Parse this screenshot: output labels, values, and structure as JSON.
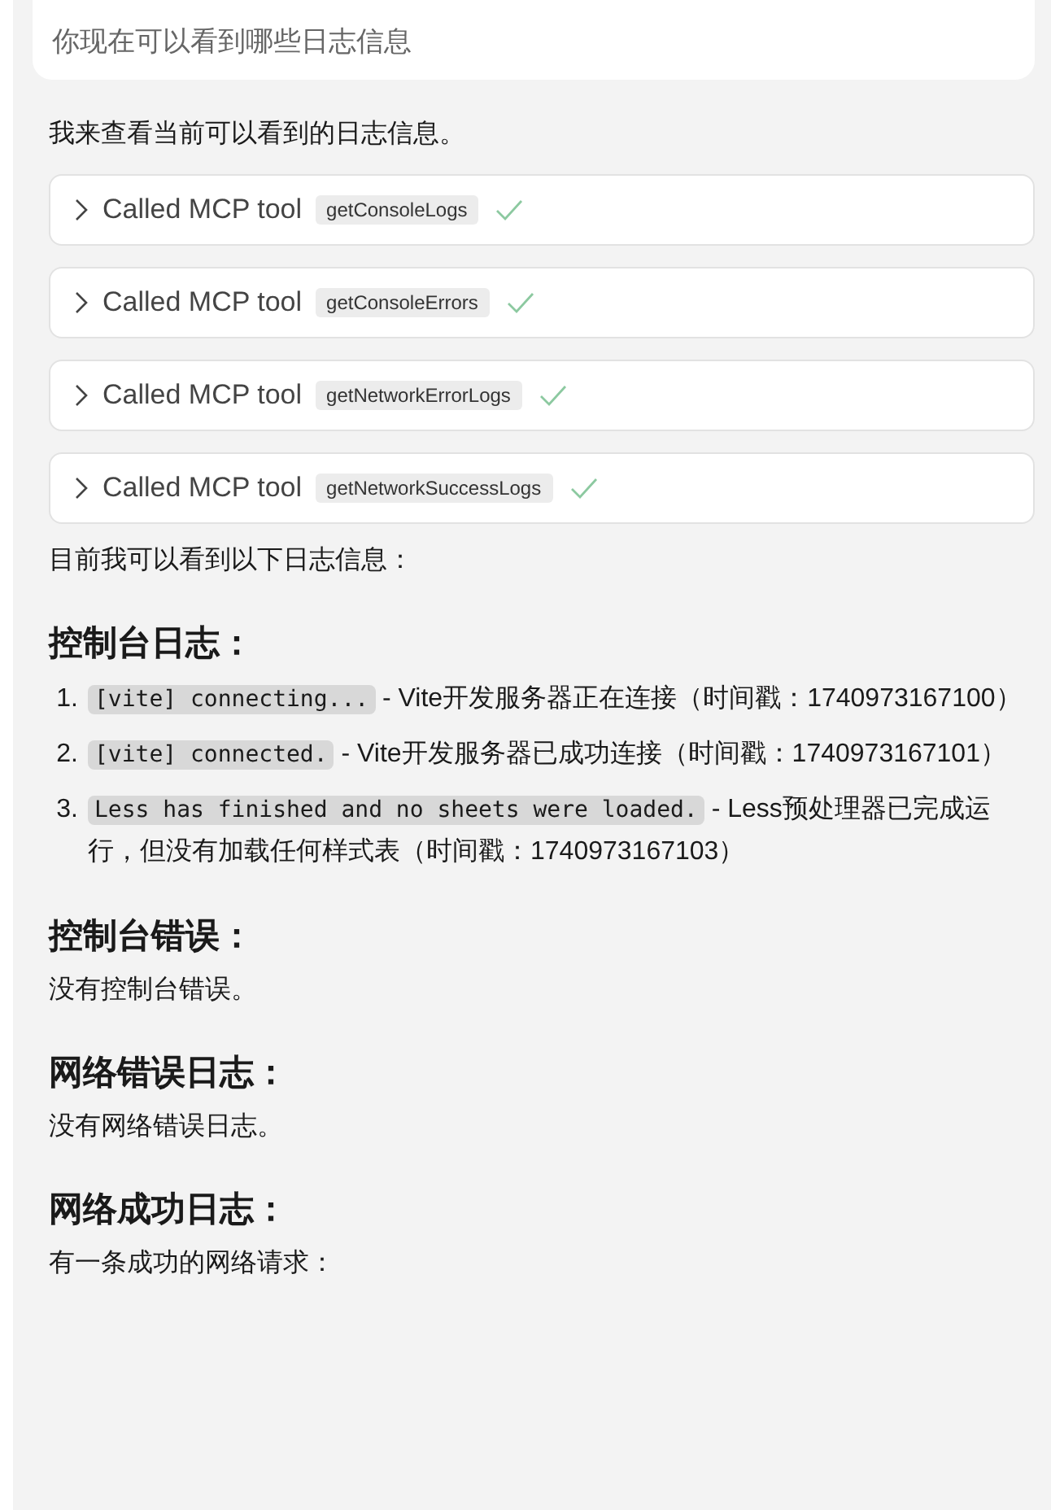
{
  "user_message": {
    "text": "你现在可以看到哪些日志信息"
  },
  "reply": {
    "intro": "我来查看当前可以看到的日志信息。",
    "tool_calls": [
      {
        "label": "Called MCP tool",
        "tool": "getConsoleLogs",
        "expanded": false,
        "done": true
      },
      {
        "label": "Called MCP tool",
        "tool": "getConsoleErrors",
        "expanded": false,
        "done": true
      },
      {
        "label": "Called MCP tool",
        "tool": "getNetworkErrorLogs",
        "expanded": false,
        "done": true
      },
      {
        "label": "Called MCP tool",
        "tool": "getNetworkSuccessLogs",
        "expanded": false,
        "done": true
      }
    ],
    "summary": "目前我可以看到以下日志信息：",
    "sections": [
      {
        "heading": "控制台日志：",
        "kind": "list",
        "items": [
          {
            "number": "1.",
            "code": "[vite] connecting...",
            "text": "- Vite开发服务器正在连接（时间戳：1740973167100）"
          },
          {
            "number": "2.",
            "code": "[vite] connected.",
            "text": "- Vite开发服务器已成功连接（时间戳：1740973167101）"
          },
          {
            "number": "3.",
            "code": "Less has finished and no sheets were loaded.",
            "text": "- Less预处理器已完成运行，但没有加载任何样式表（时间戳：1740973167103）"
          }
        ]
      },
      {
        "heading": "控制台错误：",
        "kind": "text",
        "text": "没有控制台错误。"
      },
      {
        "heading": "网络错误日志：",
        "kind": "text",
        "text": "没有网络错误日志。"
      },
      {
        "heading": "网络成功日志：",
        "kind": "text",
        "text": "有一条成功的网络请求："
      }
    ]
  }
}
